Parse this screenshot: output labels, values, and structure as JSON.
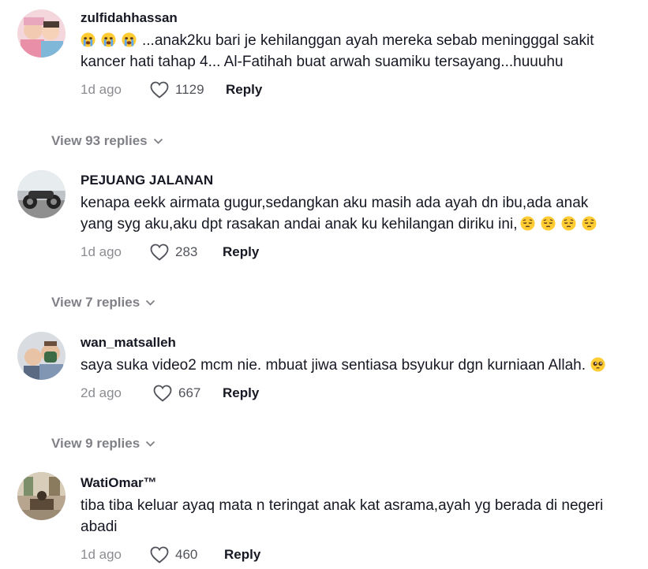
{
  "comments": [
    {
      "username": "zulfidahhassan",
      "text_before": "",
      "text": "...anak2ku bari je kehilanggan ayah mereka sebab meningggal sakit kancer hati tahap 4... Al-Fatihah buat arwah suamiku tersayang...huuuhu",
      "emoji_lead": [
        "crying-emoji",
        "crying-emoji",
        "crying-emoji"
      ],
      "date": "1d ago",
      "likes": "1129",
      "reply_label": "Reply",
      "view_replies": "View 93 replies"
    },
    {
      "username": "PEJUANG JALANAN",
      "text": "kenapa eekk airmata gugur,sedangkan aku masih ada ayah dn ibu,ada anak yang syg aku,aku dpt rasakan andai anak ku kehilangan diriku ini,",
      "emoji_trail": [
        "pensive-emoji",
        "pensive-emoji",
        "pensive-emoji",
        "pensive-emoji"
      ],
      "date": "1d ago",
      "likes": "283",
      "reply_label": "Reply",
      "view_replies": "View 7 replies"
    },
    {
      "username": "wan_matsalleh",
      "text": "saya suka video2 mcm nie. mbuat jiwa sentiasa bsyukur dgn kurniaan Allah.",
      "emoji_trail": [
        "pleading-emoji"
      ],
      "date": "2d ago",
      "likes": "667",
      "reply_label": "Reply",
      "view_replies": "View 9 replies"
    },
    {
      "username": "WatiOmar™",
      "text": "tiba tiba keluar ayaq mata n teringat anak kat asrama,ayah yg berada di negeri abadi",
      "date": "1d ago",
      "likes": "460",
      "reply_label": "Reply"
    }
  ],
  "colors": {
    "text": "#161823",
    "muted": "#8a8b91",
    "emoji_yellow": "#ffcc33"
  }
}
